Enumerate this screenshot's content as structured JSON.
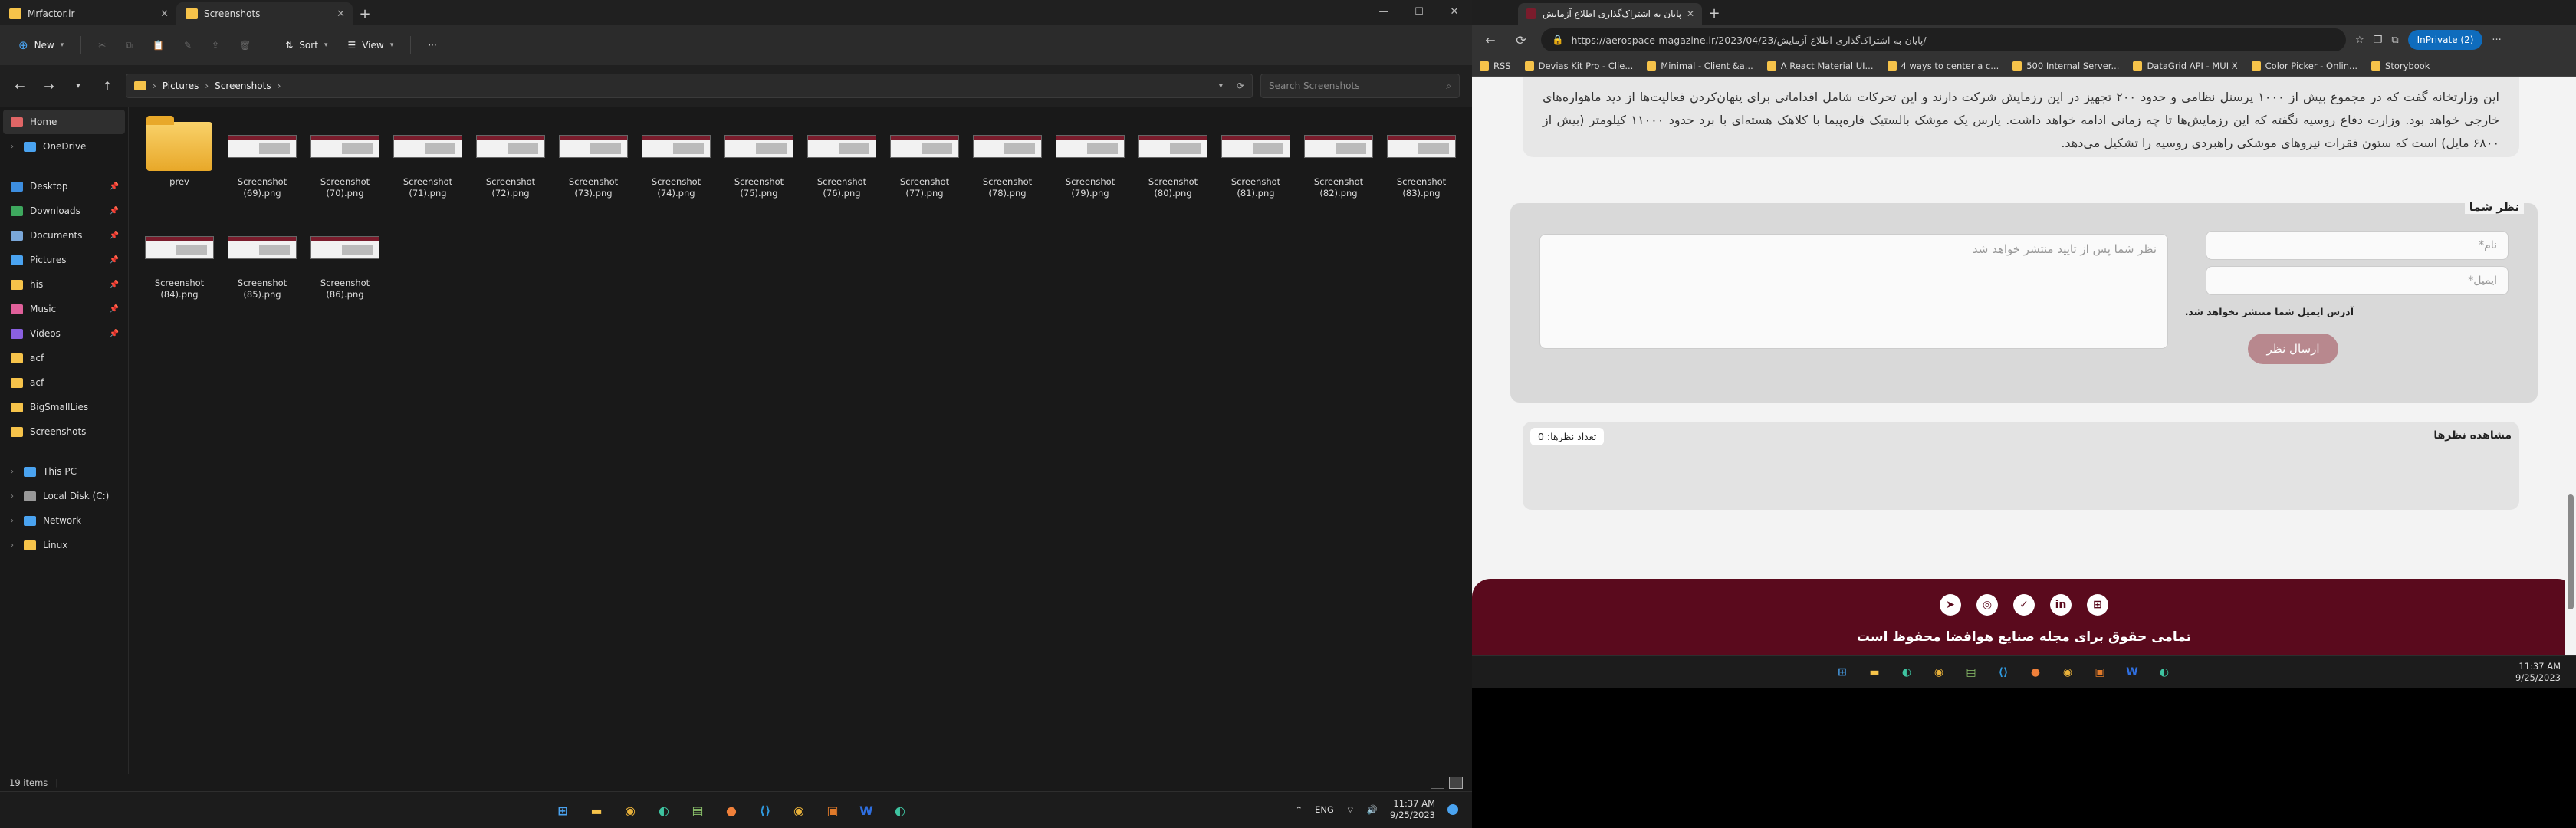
{
  "explorer": {
    "tabs": [
      {
        "label": "Mrfactor.ir",
        "active": false
      },
      {
        "label": "Screenshots",
        "active": true
      }
    ],
    "commands": {
      "new_label": "New",
      "sort_label": "Sort",
      "view_label": "View",
      "more_label": "···"
    },
    "breadcrumb": [
      "Pictures",
      "Screenshots"
    ],
    "search_placeholder": "Search Screenshots",
    "nav": [
      {
        "label": "Home",
        "icon": "home-icon",
        "pinned": false,
        "selected": true,
        "color": "#e06666"
      },
      {
        "label": "OneDrive",
        "icon": "cloud-icon",
        "pinned": false,
        "selected": false,
        "color": "#4aa3f0"
      },
      {
        "label": "Desktop",
        "icon": "desktop-icon",
        "pinned": true,
        "selected": false,
        "color": "#3d8ee0"
      },
      {
        "label": "Downloads",
        "icon": "download-icon",
        "pinned": true,
        "selected": false,
        "color": "#3ea85e"
      },
      {
        "label": "Documents",
        "icon": "document-icon",
        "pinned": true,
        "selected": false,
        "color": "#7aa7d9"
      },
      {
        "label": "Pictures",
        "icon": "picture-icon",
        "pinned": true,
        "selected": false,
        "color": "#4aa3f0"
      },
      {
        "label": "his",
        "icon": "folder-icon",
        "pinned": true,
        "selected": false,
        "color": "#f6c34a"
      },
      {
        "label": "Music",
        "icon": "music-icon",
        "pinned": true,
        "selected": false,
        "color": "#e0609a"
      },
      {
        "label": "Videos",
        "icon": "video-icon",
        "pinned": true,
        "selected": false,
        "color": "#8a60e0"
      },
      {
        "label": "acf",
        "icon": "folder-icon",
        "pinned": false,
        "selected": false,
        "color": "#f6c34a"
      },
      {
        "label": "acf",
        "icon": "folder-icon",
        "pinned": false,
        "selected": false,
        "color": "#f6c34a"
      },
      {
        "label": "BigSmallLies",
        "icon": "folder-icon",
        "pinned": false,
        "selected": false,
        "color": "#f6c34a"
      },
      {
        "label": "Screenshots",
        "icon": "folder-icon",
        "pinned": false,
        "selected": false,
        "color": "#f6c34a"
      },
      {
        "label": "This PC",
        "icon": "pc-icon",
        "pinned": false,
        "selected": false,
        "color": "#4aa3f0"
      },
      {
        "label": "Local Disk (C:)",
        "icon": "disk-icon",
        "pinned": false,
        "selected": false,
        "color": "#999999"
      },
      {
        "label": "Network",
        "icon": "network-icon",
        "pinned": false,
        "selected": false,
        "color": "#4aa3f0"
      },
      {
        "label": "Linux",
        "icon": "linux-icon",
        "pinned": false,
        "selected": false,
        "color": "#f6c34a"
      }
    ],
    "files": [
      {
        "name": "prev",
        "type": "folder"
      },
      {
        "name": "Screenshot (69).png",
        "type": "image"
      },
      {
        "name": "Screenshot (70).png",
        "type": "image"
      },
      {
        "name": "Screenshot (71).png",
        "type": "image"
      },
      {
        "name": "Screenshot (72).png",
        "type": "image"
      },
      {
        "name": "Screenshot (73).png",
        "type": "image"
      },
      {
        "name": "Screenshot (74).png",
        "type": "image"
      },
      {
        "name": "Screenshot (75).png",
        "type": "image"
      },
      {
        "name": "Screenshot (76).png",
        "type": "image"
      },
      {
        "name": "Screenshot (77).png",
        "type": "image"
      },
      {
        "name": "Screenshot (78).png",
        "type": "image"
      },
      {
        "name": "Screenshot (79).png",
        "type": "image"
      },
      {
        "name": "Screenshot (80).png",
        "type": "image"
      },
      {
        "name": "Screenshot (81).png",
        "type": "image"
      },
      {
        "name": "Screenshot (82).png",
        "type": "image"
      },
      {
        "name": "Screenshot (83).png",
        "type": "image"
      },
      {
        "name": "Screenshot (84).png",
        "type": "image"
      },
      {
        "name": "Screenshot (85).png",
        "type": "image"
      },
      {
        "name": "Screenshot (86).png",
        "type": "image"
      }
    ],
    "status_count": "19 items"
  },
  "taskbar_left": {
    "tray_lang": "ENG",
    "time": "11:37 AM",
    "date": "9/25/2023"
  },
  "browser": {
    "tab_title": "پایان به اشتراک‌گذاری اطلاع آزمایش...",
    "url": "https://aerospace-magazine.ir/2023/04/23/پایان-به-اشتراک‌گذاری-اطلاع-آزمایش/",
    "inprivate_label": "InPrivate (2)",
    "bookmarks": [
      "RSS",
      "Devias Kit Pro - Clie...",
      "Minimal - Client &a...",
      "A React Material UI...",
      "4 ways to center a c...",
      "500 Internal Server...",
      "DataGrid API - MUI X",
      "Color Picker - Onlin...",
      "Storybook"
    ]
  },
  "page": {
    "article_text": "این وزارتخانه گفت که در مجموع بیش از ۱۰۰۰ پرسنل نظامی و حدود ۲۰۰ تجهیز در این رزمایش شرکت دارند و این تحرکات شامل اقداماتی برای پنهان‌کردن فعالیت‌ها از دید ماهواره‌های خارجی خواهد بود. وزارت دفاع روسیه نگفته که این رزمایش‌ها تا چه زمانی ادامه خواهد داشت. یارس یک موشک بالستیک قاره‌پیما با کلاهک هسته‌ای با برد حدود ۱۱۰۰۰ کیلومتر (بیش از ۶۸۰۰ مایل) است که ستون فقرات نیروهای موشکی راهبردی روسیه را تشکیل می‌دهد.",
    "comment_title": "نظر شما",
    "name_placeholder": "نام*",
    "email_placeholder": "ایمیل*",
    "email_note": "آدرس ایمیل شما منتشر نخواهد شد.",
    "comment_placeholder": "نظر شما پس از تایید منتشر خواهد شد",
    "submit_label": "ارسال نظر",
    "view_title": "مشاهده نظرها",
    "count_label": "تعداد نظرها: 0",
    "footer_text": "تمامی حقوق برای مجله صنایع هوافضا محفوظ است"
  },
  "taskbar_right": {
    "time": "11:37 AM",
    "date": "9/25/2023"
  }
}
